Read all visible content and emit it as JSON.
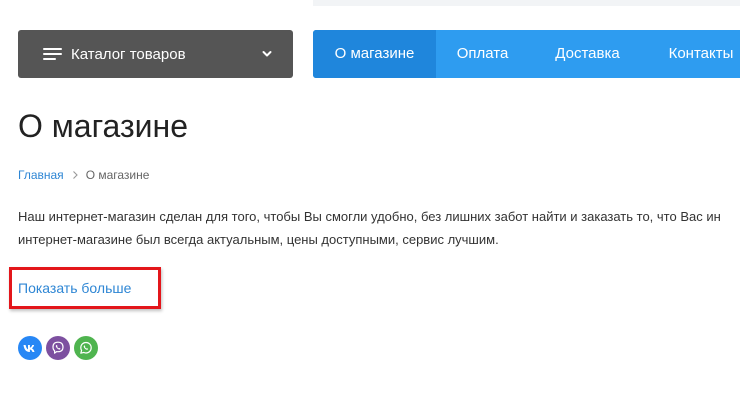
{
  "catalog": {
    "label": "Каталог товаров"
  },
  "nav": {
    "items": [
      {
        "label": "О магазине"
      },
      {
        "label": "Оплата"
      },
      {
        "label": "Доставка"
      },
      {
        "label": "Контакты"
      }
    ],
    "active_index": 0
  },
  "page": {
    "title": "О магазине"
  },
  "breadcrumb": {
    "home": "Главная",
    "current": "О магазине"
  },
  "description": {
    "line1": "Наш интернет-магазин сделан для того, чтобы Вы смогли удобно, без лишних забот найти и заказать то, что Вас ин",
    "line2": "интернет-магазине был всегда актуальным, цены доступными, сервис лучшим."
  },
  "show_more": {
    "label": "Показать больше"
  },
  "social": {
    "items": [
      {
        "name": "vk-icon",
        "color": "#2787f5"
      },
      {
        "name": "viber-icon",
        "color": "#7d50a0"
      },
      {
        "name": "whatsapp-icon",
        "color": "#4fb44f"
      }
    ]
  },
  "colors": {
    "catalog_bg": "#555555",
    "nav_bg": "#2e9cf0",
    "nav_active_bg": "#1f86dc",
    "link": "#2e86d4",
    "highlight": "#e3161b"
  }
}
